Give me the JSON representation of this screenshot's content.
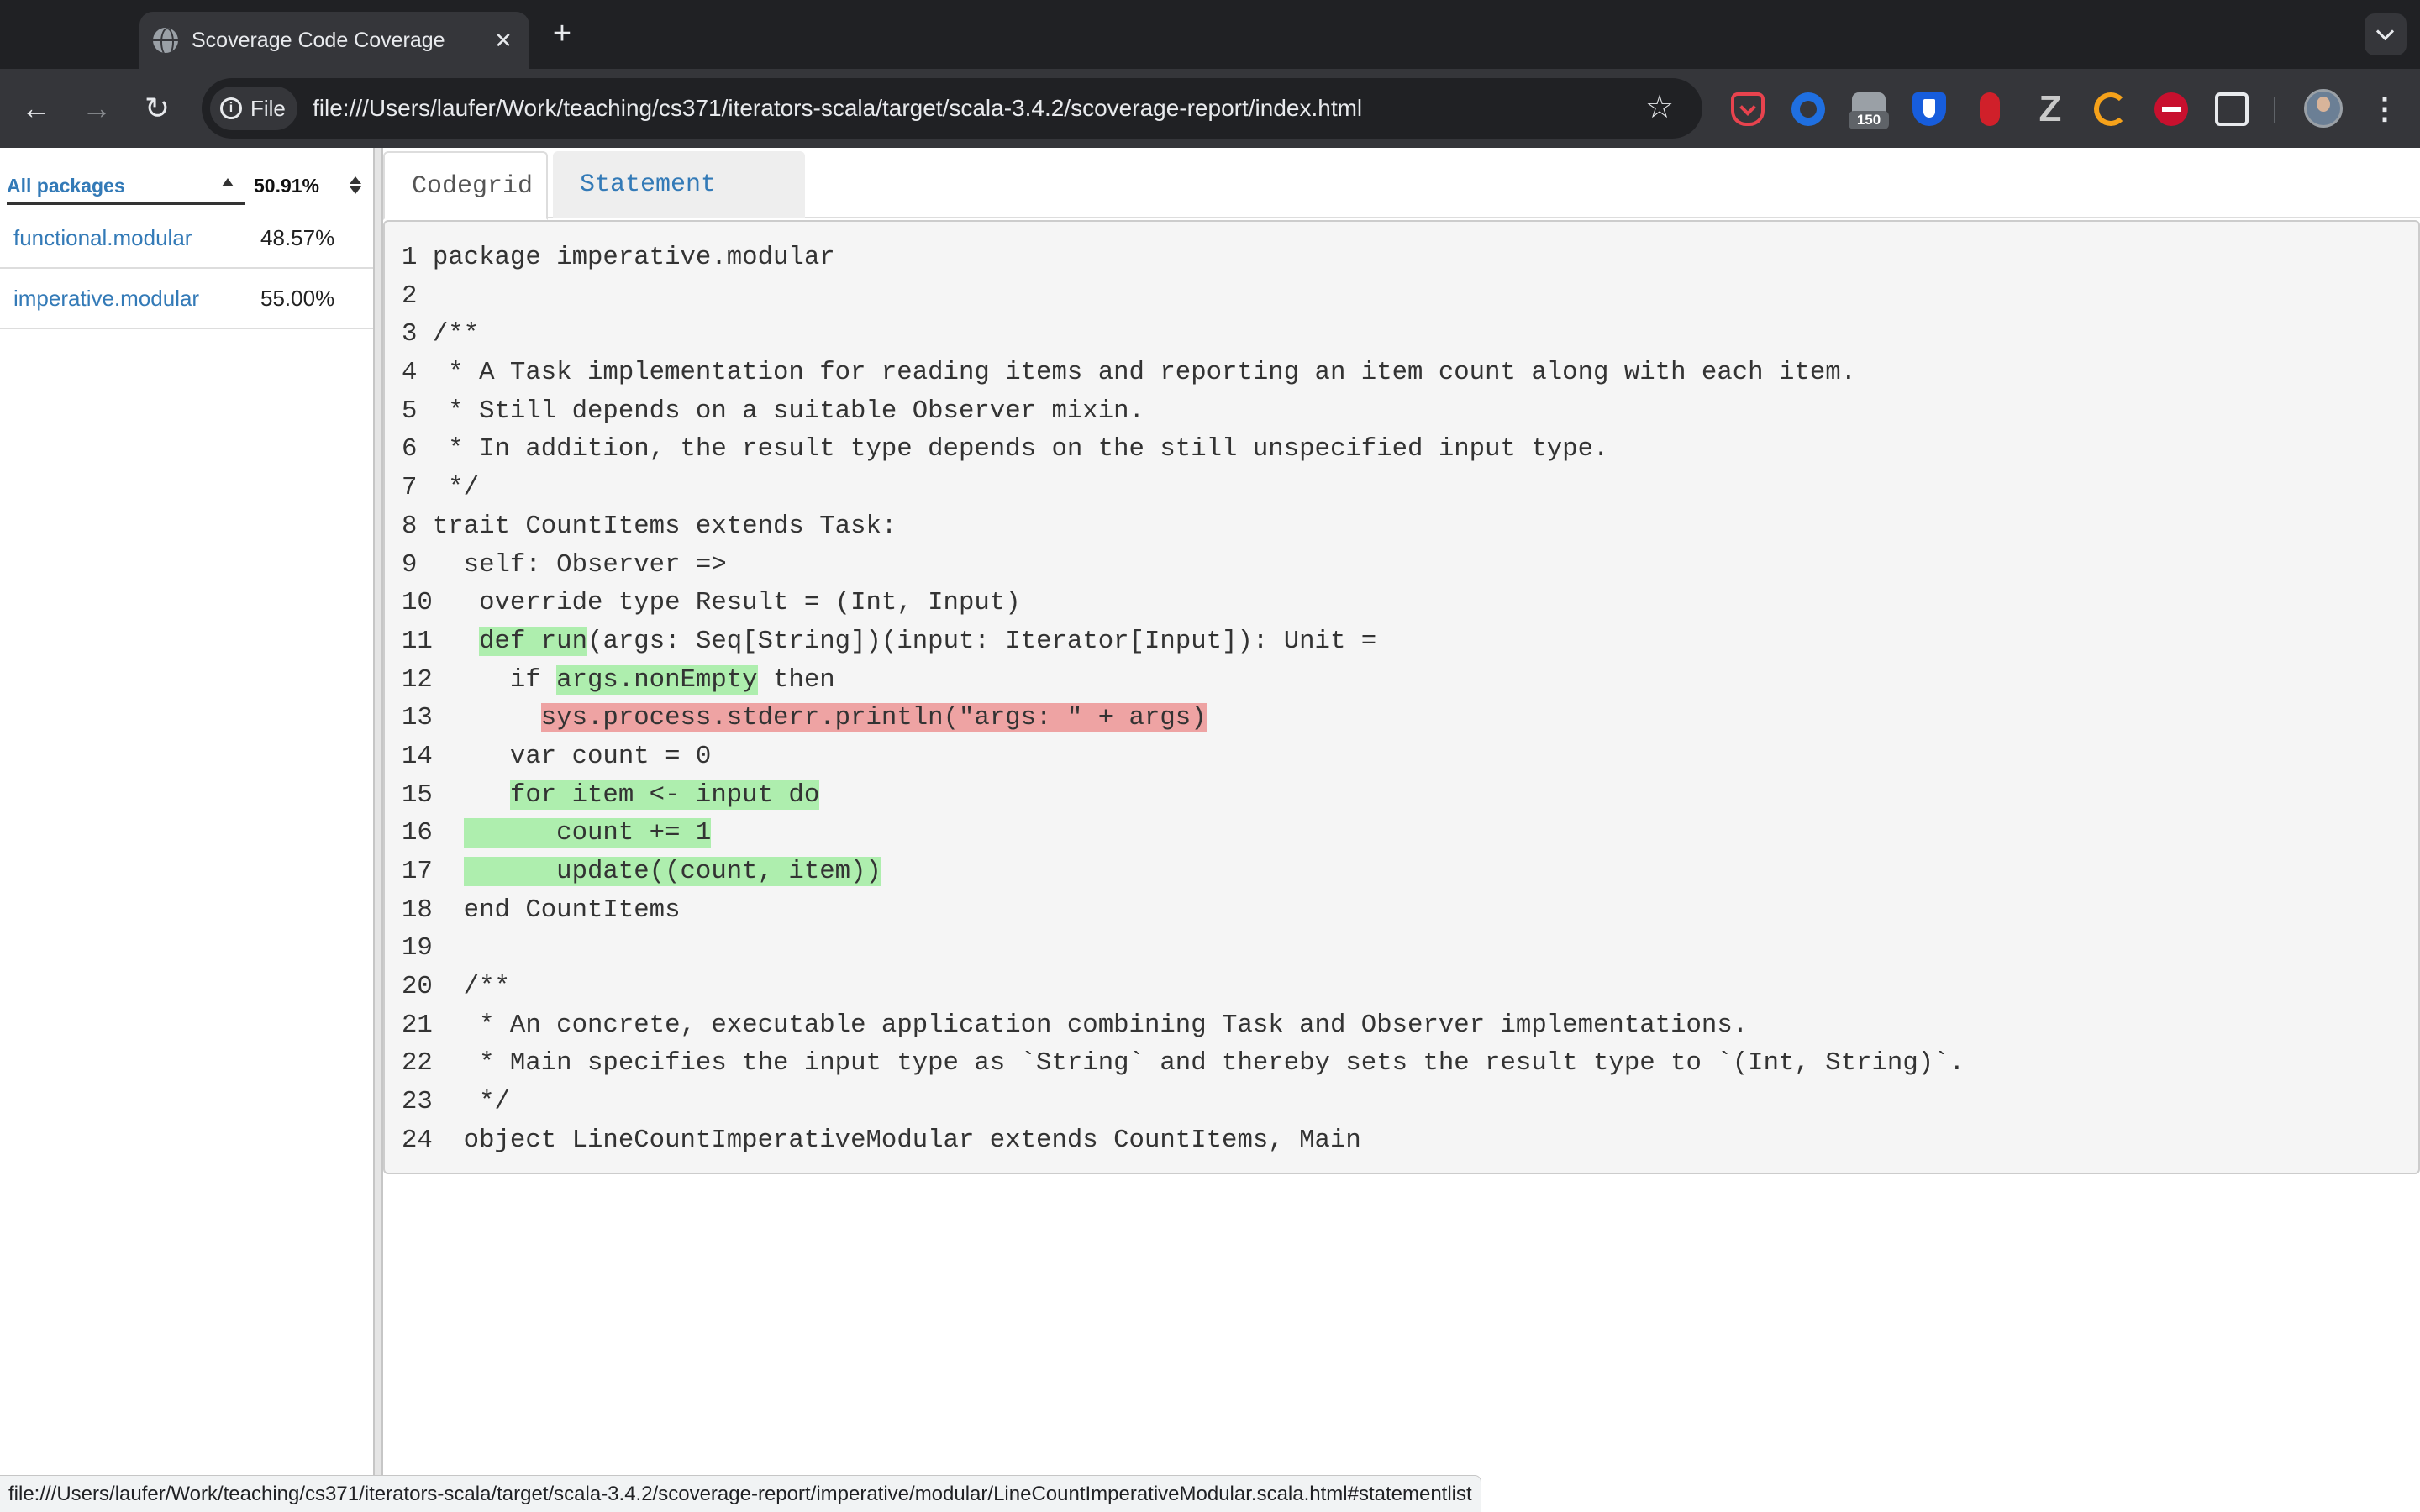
{
  "browser": {
    "tab_title": "Scoverage Code Coverage",
    "tab_close": "✕",
    "new_tab": "+",
    "back": "←",
    "forward": "→",
    "reload": "↻",
    "site_chip": "File",
    "url": "file:///Users/laufer/Work/teaching/cs371/iterators-scala/target/scala-3.4.2/scoverage-report/index.html",
    "bookmark": "☆",
    "extension_badge": "150",
    "z_ext": "Z",
    "menu": "⋮"
  },
  "sidebar": {
    "header_label": "All packages",
    "header_pct": "50.91%",
    "packages": [
      {
        "name": "functional.modular",
        "pct": "48.57%"
      },
      {
        "name": "imperative.modular",
        "pct": "55.00%"
      }
    ]
  },
  "tabs": {
    "codegrid": "Codegrid",
    "statement_list": "Statement List"
  },
  "code_lines": [
    {
      "n": "1",
      "segments": [
        {
          "t": "package imperative.modular",
          "h": ""
        }
      ]
    },
    {
      "n": "2",
      "segments": [
        {
          "t": "",
          "h": ""
        }
      ]
    },
    {
      "n": "3",
      "segments": [
        {
          "t": "/**",
          "h": ""
        }
      ]
    },
    {
      "n": "4",
      "segments": [
        {
          "t": " * A Task implementation for reading items and reporting an item count along with each item.",
          "h": ""
        }
      ]
    },
    {
      "n": "5",
      "segments": [
        {
          "t": " * Still depends on a suitable Observer mixin.",
          "h": ""
        }
      ]
    },
    {
      "n": "6",
      "segments": [
        {
          "t": " * In addition, the result type depends on the still unspecified input type.",
          "h": ""
        }
      ]
    },
    {
      "n": "7",
      "segments": [
        {
          "t": " */",
          "h": ""
        }
      ]
    },
    {
      "n": "8",
      "segments": [
        {
          "t": "trait CountItems extends Task:",
          "h": ""
        }
      ]
    },
    {
      "n": "9",
      "segments": [
        {
          "t": "  self: Observer =>",
          "h": ""
        }
      ]
    },
    {
      "n": "10",
      "segments": [
        {
          "t": "  override type Result = (Int, Input)",
          "h": ""
        }
      ]
    },
    {
      "n": "11",
      "segments": [
        {
          "t": "  ",
          "h": ""
        },
        {
          "t": "def run",
          "h": "green"
        },
        {
          "t": "(args: Seq[String])(input: Iterator[Input]): Unit =",
          "h": ""
        }
      ]
    },
    {
      "n": "12",
      "segments": [
        {
          "t": "    if ",
          "h": ""
        },
        {
          "t": "args.nonEmpty",
          "h": "green"
        },
        {
          "t": " then",
          "h": ""
        }
      ]
    },
    {
      "n": "13",
      "segments": [
        {
          "t": "      ",
          "h": ""
        },
        {
          "t": "sys.process.stderr.println(\"args: \" + args)",
          "h": "red"
        }
      ]
    },
    {
      "n": "14",
      "segments": [
        {
          "t": "    var count = 0",
          "h": ""
        }
      ]
    },
    {
      "n": "15",
      "segments": [
        {
          "t": "    ",
          "h": ""
        },
        {
          "t": "for item <- input do",
          "h": "green"
        }
      ]
    },
    {
      "n": "16",
      "segments": [
        {
          "t": " ",
          "h": ""
        },
        {
          "t": "      count += 1",
          "h": "green"
        }
      ]
    },
    {
      "n": "17",
      "segments": [
        {
          "t": " ",
          "h": ""
        },
        {
          "t": "      update((count, item))",
          "h": "green"
        }
      ]
    },
    {
      "n": "18",
      "segments": [
        {
          "t": " end CountItems",
          "h": ""
        }
      ]
    },
    {
      "n": "19",
      "segments": [
        {
          "t": "",
          "h": ""
        }
      ]
    },
    {
      "n": "20",
      "segments": [
        {
          "t": " /**",
          "h": ""
        }
      ]
    },
    {
      "n": "21",
      "segments": [
        {
          "t": "  * An concrete, executable application combining Task and Observer implementations.",
          "h": ""
        }
      ]
    },
    {
      "n": "22",
      "segments": [
        {
          "t": "  * Main specifies the input type as `String` and thereby sets the result type to `(Int, String)`.",
          "h": ""
        }
      ]
    },
    {
      "n": "23",
      "segments": [
        {
          "t": "  */",
          "h": ""
        }
      ]
    },
    {
      "n": "24",
      "segments": [
        {
          "t": " object LineCountImperativeModular extends CountItems, Main",
          "h": ""
        }
      ]
    }
  ],
  "status_url": "file:///Users/laufer/Work/teaching/cs371/iterators-scala/target/scala-3.4.2/scoverage-report/imperative/modular/LineCountImperativeModular.scala.html#statementlist",
  "colors": {
    "covered": "#aeeeae",
    "uncovered": "#eea3a3",
    "link": "#337ab7"
  },
  "icons": {
    "tab_favicon": "globe-icon",
    "info": "info-icon",
    "bookmark": "star-icon",
    "extensions": [
      "pocket-icon",
      "blue-swirl-icon",
      "badge-icon",
      "bitwarden-icon",
      "microphone-icon",
      "z-icon",
      "orange-arc-icon",
      "stop-sign-icon",
      "puzzle-icon"
    ],
    "profile": "avatar",
    "menu": "kebab-menu-icon"
  }
}
